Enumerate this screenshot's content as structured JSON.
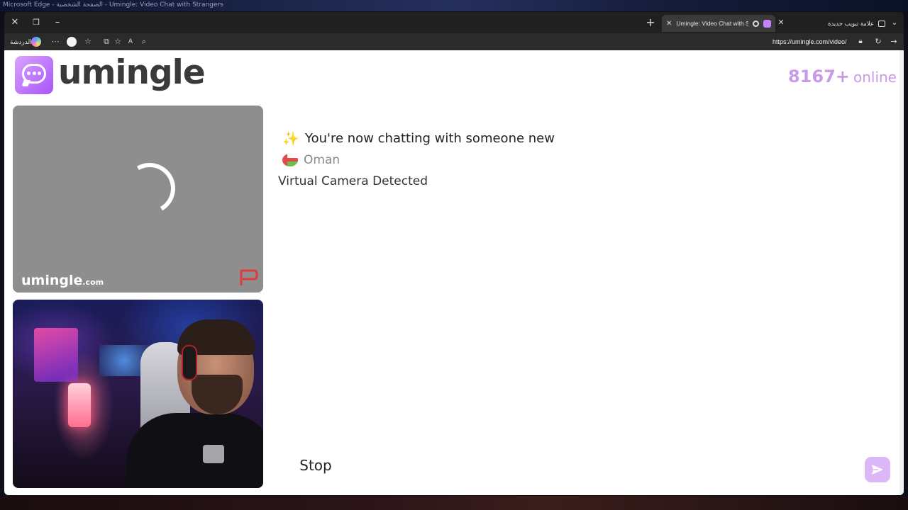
{
  "window": {
    "os_title": "Microsoft Edge - الصفحة الشخصية - Umingle: Video Chat with Strangers"
  },
  "tabs": [
    {
      "label": "Umingle: Video Chat with Stra",
      "active": true
    },
    {
      "label": "علامة تبويب جديدة",
      "active": false
    }
  ],
  "addressbar": {
    "url": "https://umingle.com/video/",
    "workspace_label": "الدردشة"
  },
  "header": {
    "brand": "umingle",
    "online_count": "8167+",
    "online_label": "online"
  },
  "stranger_video": {
    "watermark_main": "umingle",
    "watermark_suffix": ".com",
    "report_icon": "report-flag-icon"
  },
  "chat": {
    "status_message": "You're now chatting with someone new",
    "country": "Oman",
    "warning": "Virtual Camera Detected"
  },
  "controls": {
    "stop_label": "Stop",
    "send_icon": "send-icon"
  },
  "colors": {
    "accent": "#c89ae8",
    "logo_gradient_start": "#d9a2ff",
    "logo_gradient_end": "#a855f7",
    "send_button": "#dcb7f7",
    "stranger_video_bg": "#8e8e8e"
  }
}
